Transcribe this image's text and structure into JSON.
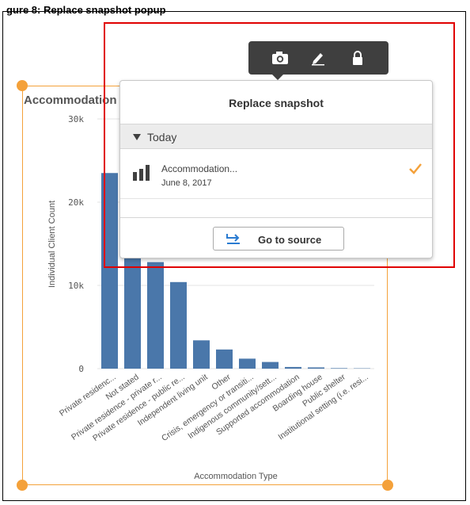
{
  "document": {
    "cropped_heading": "gure 8: Replace snapshot popup"
  },
  "chart": {
    "title": "Accommodation Type",
    "colors": {
      "bar": "#4a77aa",
      "grid": "#e3e3e3",
      "accent": "#f4a13a",
      "highlight": "#e00000"
    }
  },
  "chart_data": {
    "type": "bar",
    "xlabel": "Accommodation Type",
    "ylabel": "Individual Client Count",
    "yticks": [
      "0",
      "10k",
      "20k",
      "30k"
    ],
    "ylim": [
      0,
      30000
    ],
    "categories": [
      "Private residenc...",
      "Not stated",
      "Private residence - private r...",
      "Private residence - public re...",
      "Independent living unit",
      "Other",
      "Crisis, emergency or transiti...",
      "Indigenous community/sett...",
      "Supported accommodation",
      "Boarding house",
      "Public shelter",
      "Institutional setting (i.e. resi..."
    ],
    "values": [
      23500,
      16000,
      12800,
      10400,
      3400,
      2300,
      1200,
      800,
      200,
      150,
      60,
      40
    ]
  },
  "toolbar": {
    "icons": [
      "camera-icon",
      "pencil-icon",
      "lock-icon"
    ]
  },
  "popup": {
    "title": "Replace snapshot",
    "section_label": "Today",
    "snapshot": {
      "name": "Accommodation...",
      "date": "June 8, 2017"
    },
    "go_to_source": "Go to source"
  }
}
